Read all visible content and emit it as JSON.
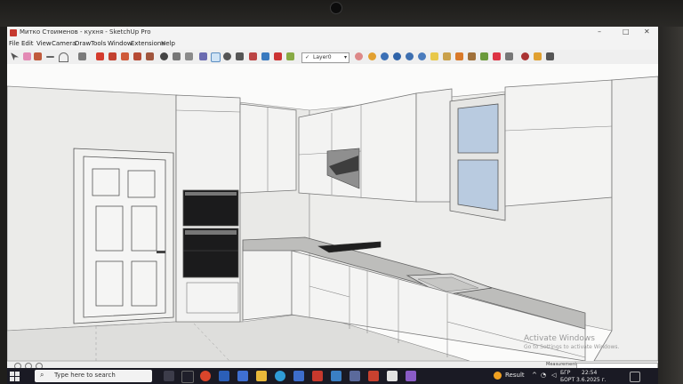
{
  "window": {
    "title": "Митко Стоименов - кухня - SketchUp Pro",
    "controls": [
      "–",
      "□",
      "✕"
    ]
  },
  "menu": [
    "File",
    "Edit",
    "View",
    "Camera",
    "Draw",
    "Tools",
    "Window",
    "Extensions",
    "Help"
  ],
  "toolbar": {
    "layer_name": "Layer0",
    "layer_check": "✓",
    "dropdown_arrow": "▾",
    "icons": [
      "select-icon",
      "eraser-icon",
      "paint-bucket-icon",
      "line-icon",
      "arc-icon",
      "rectangle-icon",
      "push-pull-icon",
      "move-icon",
      "rotate-icon",
      "scale-icon",
      "offset-icon",
      "tape-measure-icon",
      "text-icon",
      "orbit-icon",
      "pan-icon",
      "zoom-icon",
      "zoom-extents-icon",
      "components-icon",
      "materials-icon",
      "styles-icon",
      "warehouse-icon",
      "extension-icon"
    ]
  },
  "status": {
    "measurements_label": "Measurements"
  },
  "watermark": {
    "line1": "Activate Windows",
    "line2": "Go to Settings to activate Windows."
  },
  "taskbar": {
    "search_placeholder": "Type here to search",
    "weather": "Result",
    "language_line1": "БГР",
    "language_line2": "БОРТ",
    "time": "22:54",
    "date": "3.6.2025 г."
  },
  "colors": {
    "taskbar": "#1a1a24",
    "viewport_bg": "#fbfbfa",
    "wall": "#ececea",
    "floor": "#dededc",
    "cabinet": "#f3f3f2",
    "countertop": "#bdbdbb",
    "oven_glass": "#1b1b1c",
    "window_glass": "#b9cbe0"
  }
}
